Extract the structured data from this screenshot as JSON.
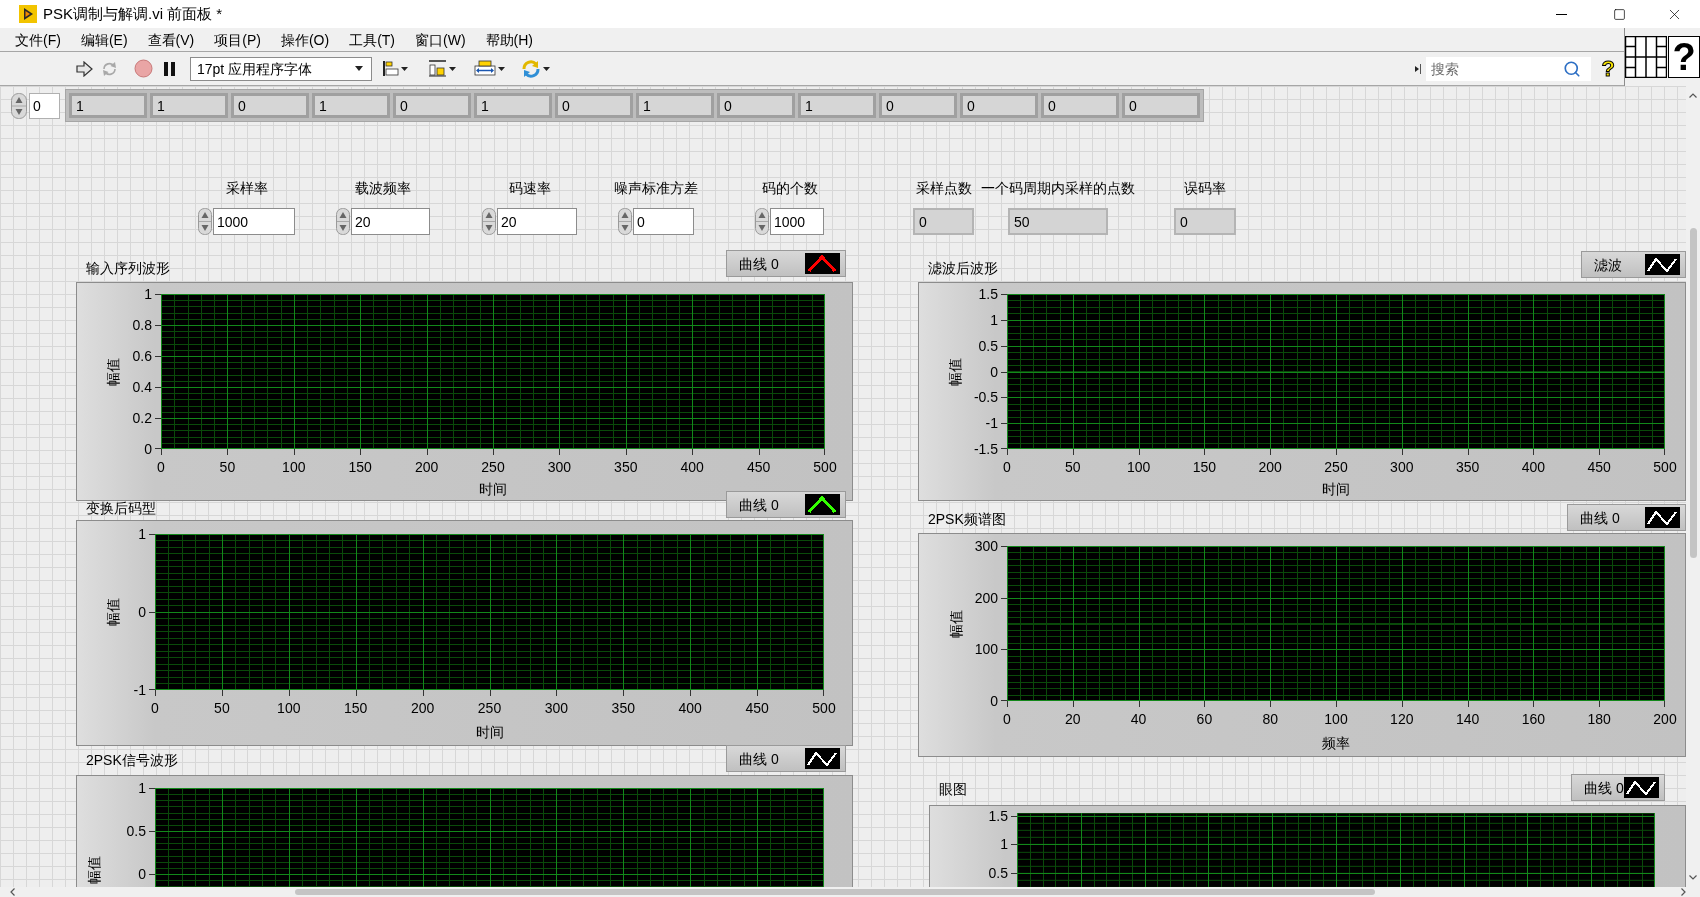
{
  "window": {
    "title": "PSK调制与解调.vi 前面板 *"
  },
  "menu": [
    "文件(F)",
    "编辑(E)",
    "查看(V)",
    "项目(P)",
    "操作(O)",
    "工具(T)",
    "窗口(W)",
    "帮助(H)"
  ],
  "toolbar": {
    "font_menu": "17pt 应用程序字体",
    "search": {
      "placeholder": "搜索"
    },
    "help": "?"
  },
  "vi_icon": "?",
  "array": {
    "index": "0",
    "elements": [
      "1",
      "1",
      "0",
      "1",
      "0",
      "1",
      "0",
      "1",
      "0",
      "1",
      "0",
      "0",
      "0",
      "0"
    ]
  },
  "controls": [
    {
      "kind": "control",
      "label": "采样率",
      "value": "1000"
    },
    {
      "kind": "control",
      "label": "载波频率",
      "value": "20"
    },
    {
      "kind": "control",
      "label": "码速率",
      "value": "20"
    },
    {
      "kind": "control",
      "label": "噪声标准方差",
      "value": "0"
    },
    {
      "kind": "control",
      "label": "码的个数",
      "value": "1000"
    },
    {
      "kind": "indicator",
      "label": "采样点数",
      "value": "0"
    },
    {
      "kind": "indicator",
      "label": "一个码周期内采样的点数",
      "value": "50"
    },
    {
      "kind": "indicator",
      "label": "误码率",
      "value": "0"
    }
  ],
  "left_graphs": [
    {
      "legend": {
        "name": "曲线 0",
        "color": "#ff0000",
        "kind": "thick"
      },
      "chart_data": {
        "type": "line",
        "title": "输入序列波形",
        "xlabel": "时间",
        "ylabel": "幅值",
        "xlim": [
          0,
          500
        ],
        "ylim": [
          0,
          1
        ],
        "grid": true,
        "xticks": [
          0,
          50,
          100,
          150,
          200,
          250,
          300,
          350,
          400,
          450,
          500
        ],
        "yticks": [
          0,
          0.2,
          0.4,
          0.6,
          0.8,
          1
        ]
      }
    },
    {
      "legend": {
        "name": "曲线 0",
        "color": "#33ff00",
        "kind": "thick"
      },
      "chart_data": {
        "type": "line",
        "title": "变换后码型",
        "xlabel": "时间",
        "ylabel": "幅值",
        "xlim": [
          0,
          500
        ],
        "ylim": [
          -1,
          1
        ],
        "grid": true,
        "xticks": [
          0,
          50,
          100,
          150,
          200,
          250,
          300,
          350,
          400,
          450,
          500
        ],
        "yticks": [
          -1,
          0,
          1
        ]
      }
    },
    {
      "legend": {
        "name": "曲线 0",
        "color": "#ffffff",
        "kind": "thin"
      },
      "chart_data": {
        "type": "line",
        "title": "2PSK信号波形",
        "ylabel": "幅值",
        "categories": [
          null,
          null,
          null,
          null,
          null,
          null,
          null,
          null,
          null,
          null,
          null
        ],
        "ylim": [
          -0.15,
          1
        ],
        "grid": true,
        "yticks": [
          0,
          0.5,
          1
        ]
      }
    }
  ],
  "right_graphs": [
    {
      "legend": {
        "name": "滤波",
        "color": "#ffffff",
        "kind": "thin"
      },
      "chart_data": {
        "type": "line",
        "title": "滤波后波形",
        "xlabel": "时间",
        "ylabel": "幅值",
        "xlim": [
          0,
          500
        ],
        "ylim": [
          -1.5,
          1.5
        ],
        "grid": true,
        "xticks": [
          0,
          50,
          100,
          150,
          200,
          250,
          300,
          350,
          400,
          450,
          500
        ],
        "yticks": [
          -1.5,
          -1,
          -0.5,
          0,
          0.5,
          1,
          1.5
        ]
      }
    },
    {
      "legend": {
        "name": "曲线 0",
        "color": "#ffffff",
        "kind": "thin"
      },
      "chart_data": {
        "type": "line",
        "title": "2PSK频谱图",
        "xlabel": "频率",
        "ylabel": "幅值",
        "xlim": [
          0,
          200
        ],
        "ylim": [
          0,
          300
        ],
        "grid": true,
        "xticks": [
          0,
          20,
          40,
          60,
          80,
          100,
          120,
          140,
          160,
          180,
          200
        ],
        "yticks": [
          0,
          100,
          200,
          300
        ]
      }
    },
    {
      "legend": {
        "name": "曲线 0",
        "color": "#ffffff",
        "kind": "thin"
      },
      "chart_data": {
        "type": "line",
        "title": "眼图",
        "categories": [
          null,
          null,
          null,
          null,
          null,
          null,
          null,
          null,
          null,
          null,
          null
        ],
        "ylim": [
          0.25,
          1.55
        ],
        "grid": true,
        "yticks": [
          0.5,
          1,
          1.5
        ]
      }
    }
  ]
}
